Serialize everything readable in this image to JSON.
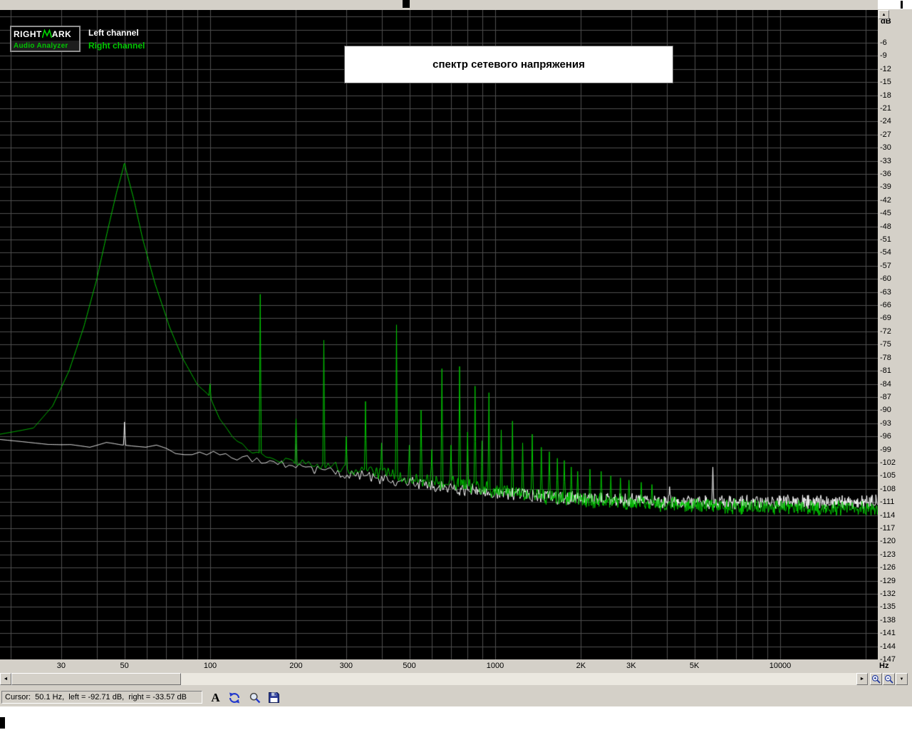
{
  "window": {
    "bg": "#d4d0c8",
    "plot_bg": "#000000",
    "grid_color": "#4e4e4e"
  },
  "logo": {
    "line1_left": "RIGHT",
    "line1_right": "ARK",
    "line2": "Audio Analyzer",
    "green": "#00d800",
    "text2_color": "#00c400"
  },
  "legend": {
    "left_label": "Left channel",
    "right_label": "Right channel",
    "left_color": "#ffffff",
    "right_color": "#00c800"
  },
  "title": "спектр сетевого напряжения",
  "axes": {
    "y_unit": "dB",
    "x_unit": "Hz"
  },
  "icons": {
    "scroll_up": "▲",
    "scroll_down": "▼",
    "scroll_left": "◄",
    "scroll_right": "►"
  },
  "toolbar": {
    "font_button_label": "A"
  },
  "status": {
    "cursor_text": "Cursor:  50.1 Hz,  left = -92.71 dB,  right = -33.57 dB"
  },
  "chart_data": {
    "type": "line",
    "title": "спектр сетевого напряжения",
    "xlabel": "Hz",
    "ylabel": "dB",
    "x_scale": "log",
    "xlim": [
      18.3,
      22600
    ],
    "ylim": [
      -147,
      1.5
    ],
    "grid": true,
    "legend_position": "top-left",
    "fft_bin_hz": 5.4,
    "x_ticks": [
      {
        "f": 30,
        "label": "30"
      },
      {
        "f": 50,
        "label": "50"
      },
      {
        "f": 100,
        "label": "100"
      },
      {
        "f": 200,
        "label": "200"
      },
      {
        "f": 300,
        "label": "300"
      },
      {
        "f": 500,
        "label": "500"
      },
      {
        "f": 1000,
        "label": "1000"
      },
      {
        "f": 2000,
        "label": "2K"
      },
      {
        "f": 3000,
        "label": "3K"
      },
      {
        "f": 5000,
        "label": "5K"
      },
      {
        "f": 10000,
        "label": "10000"
      }
    ],
    "y_tick_labels": [
      "-6",
      "-9",
      "-12",
      "-15",
      "-18",
      "-21",
      "-24",
      "-27",
      "-30",
      "-33",
      "-36",
      "-39",
      "-42",
      "-45",
      "-48",
      "-51",
      "-54",
      "-57",
      "-60",
      "-63",
      "-66",
      "-69",
      "-72",
      "-75",
      "-78",
      "-81",
      "-84",
      "-87",
      "-90",
      "-93",
      "-96",
      "-99",
      "-102",
      "-105",
      "-108",
      "-111",
      "-114",
      "-117",
      "-120",
      "-123",
      "-126",
      "-129",
      "-132",
      "-135",
      "-138",
      "-141",
      "-144",
      "-147"
    ],
    "cursor": {
      "freq_hz": 50.1,
      "left_db": -92.71,
      "right_db": -33.57
    },
    "series": [
      {
        "name": "Left channel",
        "color": "#ffffff",
        "seed": 7,
        "noise_db": 1.7,
        "noise_min": 0.5,
        "noise_lo": 2.0,
        "noise_hi": 3.0,
        "floor_db": [
          [
            18.3,
            -96.5
          ],
          [
            30,
            -97.5
          ],
          [
            45,
            -98
          ],
          [
            60,
            -98.6
          ],
          [
            80,
            -99.3
          ],
          [
            100,
            -100
          ],
          [
            140,
            -101.2
          ],
          [
            200,
            -103
          ],
          [
            300,
            -104.5
          ],
          [
            500,
            -106.5
          ],
          [
            800,
            -108.3
          ],
          [
            1500,
            -109.8
          ],
          [
            3000,
            -110.6
          ],
          [
            6000,
            -111
          ],
          [
            22000,
            -111
          ]
        ],
        "peaks_db": [
          [
            50,
            -92.71
          ],
          [
            4100,
            -107.5
          ],
          [
            5800,
            -103
          ]
        ]
      },
      {
        "name": "Right channel",
        "color": "#00c800",
        "seed": 99,
        "noise_db": 1.9,
        "noise_min": 0.06,
        "noise_lo": 2.05,
        "noise_hi": 2.62,
        "floor_db": [
          [
            18.3,
            -95.5
          ],
          [
            24,
            -94
          ],
          [
            28,
            -89
          ],
          [
            32,
            -81
          ],
          [
            36,
            -71
          ],
          [
            40,
            -60
          ],
          [
            44,
            -48
          ],
          [
            47,
            -40
          ],
          [
            50,
            -33.57
          ],
          [
            54,
            -42
          ],
          [
            58,
            -51
          ],
          [
            64,
            -61
          ],
          [
            72,
            -71
          ],
          [
            80,
            -78
          ],
          [
            90,
            -84
          ],
          [
            100,
            -87
          ],
          [
            108,
            -92
          ],
          [
            120,
            -96
          ],
          [
            135,
            -99
          ],
          [
            160,
            -101
          ],
          [
            200,
            -102
          ],
          [
            300,
            -103.5
          ],
          [
            450,
            -105
          ],
          [
            700,
            -106.8
          ],
          [
            1000,
            -108.2
          ],
          [
            1500,
            -109.8
          ],
          [
            2200,
            -110.8
          ],
          [
            3500,
            -111.5
          ],
          [
            6000,
            -112
          ],
          [
            22000,
            -112.4
          ]
        ],
        "peaks_db": [
          [
            50,
            -33.57
          ],
          [
            100,
            -84
          ],
          [
            150,
            -63.5
          ],
          [
            200,
            -92
          ],
          [
            250,
            -74
          ],
          [
            300,
            -96
          ],
          [
            350,
            -88
          ],
          [
            400,
            -97.5
          ],
          [
            450,
            -70.5
          ],
          [
            500,
            -98
          ],
          [
            550,
            -90
          ],
          [
            600,
            -99
          ],
          [
            650,
            -80.5
          ],
          [
            700,
            -98
          ],
          [
            750,
            -80
          ],
          [
            800,
            -95
          ],
          [
            850,
            -84.5
          ],
          [
            900,
            -97
          ],
          [
            950,
            -86
          ],
          [
            1050,
            -94.5
          ],
          [
            1150,
            -92.5
          ],
          [
            1250,
            -97.5
          ],
          [
            1350,
            -95.5
          ],
          [
            1450,
            -98.5
          ],
          [
            1550,
            -99.5
          ],
          [
            1650,
            -101
          ],
          [
            1750,
            -101.5
          ],
          [
            1850,
            -103
          ],
          [
            1950,
            -104
          ],
          [
            2150,
            -103.5
          ],
          [
            2350,
            -104
          ],
          [
            2550,
            -105
          ],
          [
            2750,
            -105.5
          ],
          [
            2950,
            -106
          ],
          [
            3250,
            -106.5
          ],
          [
            3550,
            -107
          ]
        ]
      }
    ]
  }
}
